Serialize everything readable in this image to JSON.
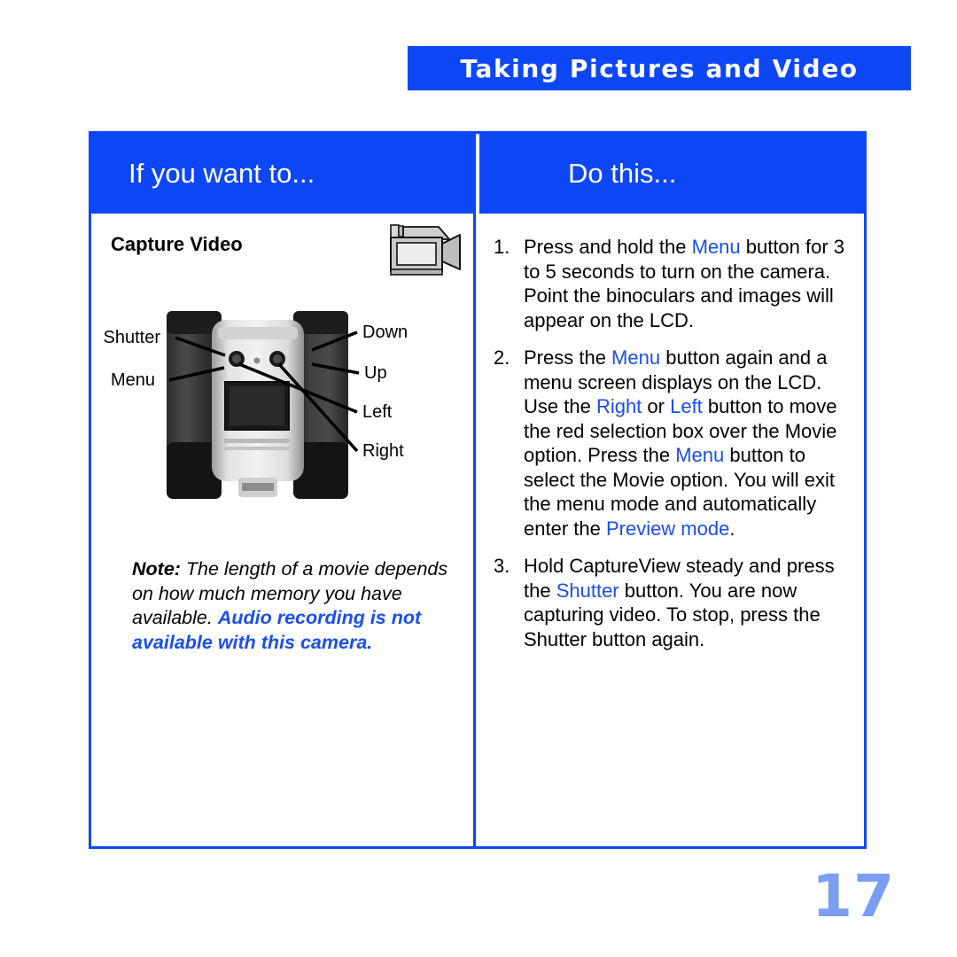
{
  "header": {
    "title": "Taking Pictures and Video",
    "banner_color": "#0d47f5"
  },
  "table": {
    "columns": [
      {
        "label": "If you want to..."
      },
      {
        "label": "Do this..."
      }
    ],
    "border_color": "#0d47f5"
  },
  "left_cell": {
    "heading": "Capture Video",
    "icon": "camcorder-icon",
    "figure": {
      "name": "binoculars-photo",
      "callouts_left": [
        {
          "label": "Shutter"
        },
        {
          "label": "Menu"
        }
      ],
      "callouts_right": [
        {
          "label": "Down"
        },
        {
          "label": "Up"
        },
        {
          "label": "Left"
        },
        {
          "label": "Right"
        }
      ]
    },
    "note": {
      "label": "Note:",
      "body_black": " The length of a movie depends on how much memory you have available.",
      "body_blue": "Audio recording is not available with this camera.",
      "blue_color": "#1a4ef0"
    }
  },
  "right_cell": {
    "steps": [
      {
        "number": "1.",
        "parts": [
          {
            "text": "Press and hold the ",
            "highlight": false
          },
          {
            "text": "Menu",
            "highlight": true
          },
          {
            "text": " button for 3 to 5 seconds to turn on the camera. Point the binoculars and images will appear on the LCD.",
            "highlight": false
          }
        ]
      },
      {
        "number": "2.",
        "parts": [
          {
            "text": "Press the ",
            "highlight": false
          },
          {
            "text": "Menu",
            "highlight": true
          },
          {
            "text": " button again and a menu screen displays on the LCD. Use the ",
            "highlight": false
          },
          {
            "text": "Right",
            "highlight": true
          },
          {
            "text": " or ",
            "highlight": false
          },
          {
            "text": "Left",
            "highlight": true
          },
          {
            "text": " button to move the red selection box over the  Movie option. Press the ",
            "highlight": false
          },
          {
            "text": "Menu",
            "highlight": true
          },
          {
            "text": " button to select the Movie option. You will exit the menu mode and automatically enter the ",
            "highlight": false
          },
          {
            "text": "Preview mode",
            "highlight": true
          },
          {
            "text": ".",
            "highlight": false
          }
        ]
      },
      {
        "number": "3.",
        "parts": [
          {
            "text": "Hold CaptureView steady and press the ",
            "highlight": false
          },
          {
            "text": "Shutter",
            "highlight": true
          },
          {
            "text": " button. You are now capturing video. To stop, press the Shutter button again.",
            "highlight": false
          }
        ]
      }
    ],
    "highlight_color": "#1a4ef0"
  },
  "footer": {
    "page_number": "17",
    "page_number_color": "#7b9ef2"
  }
}
